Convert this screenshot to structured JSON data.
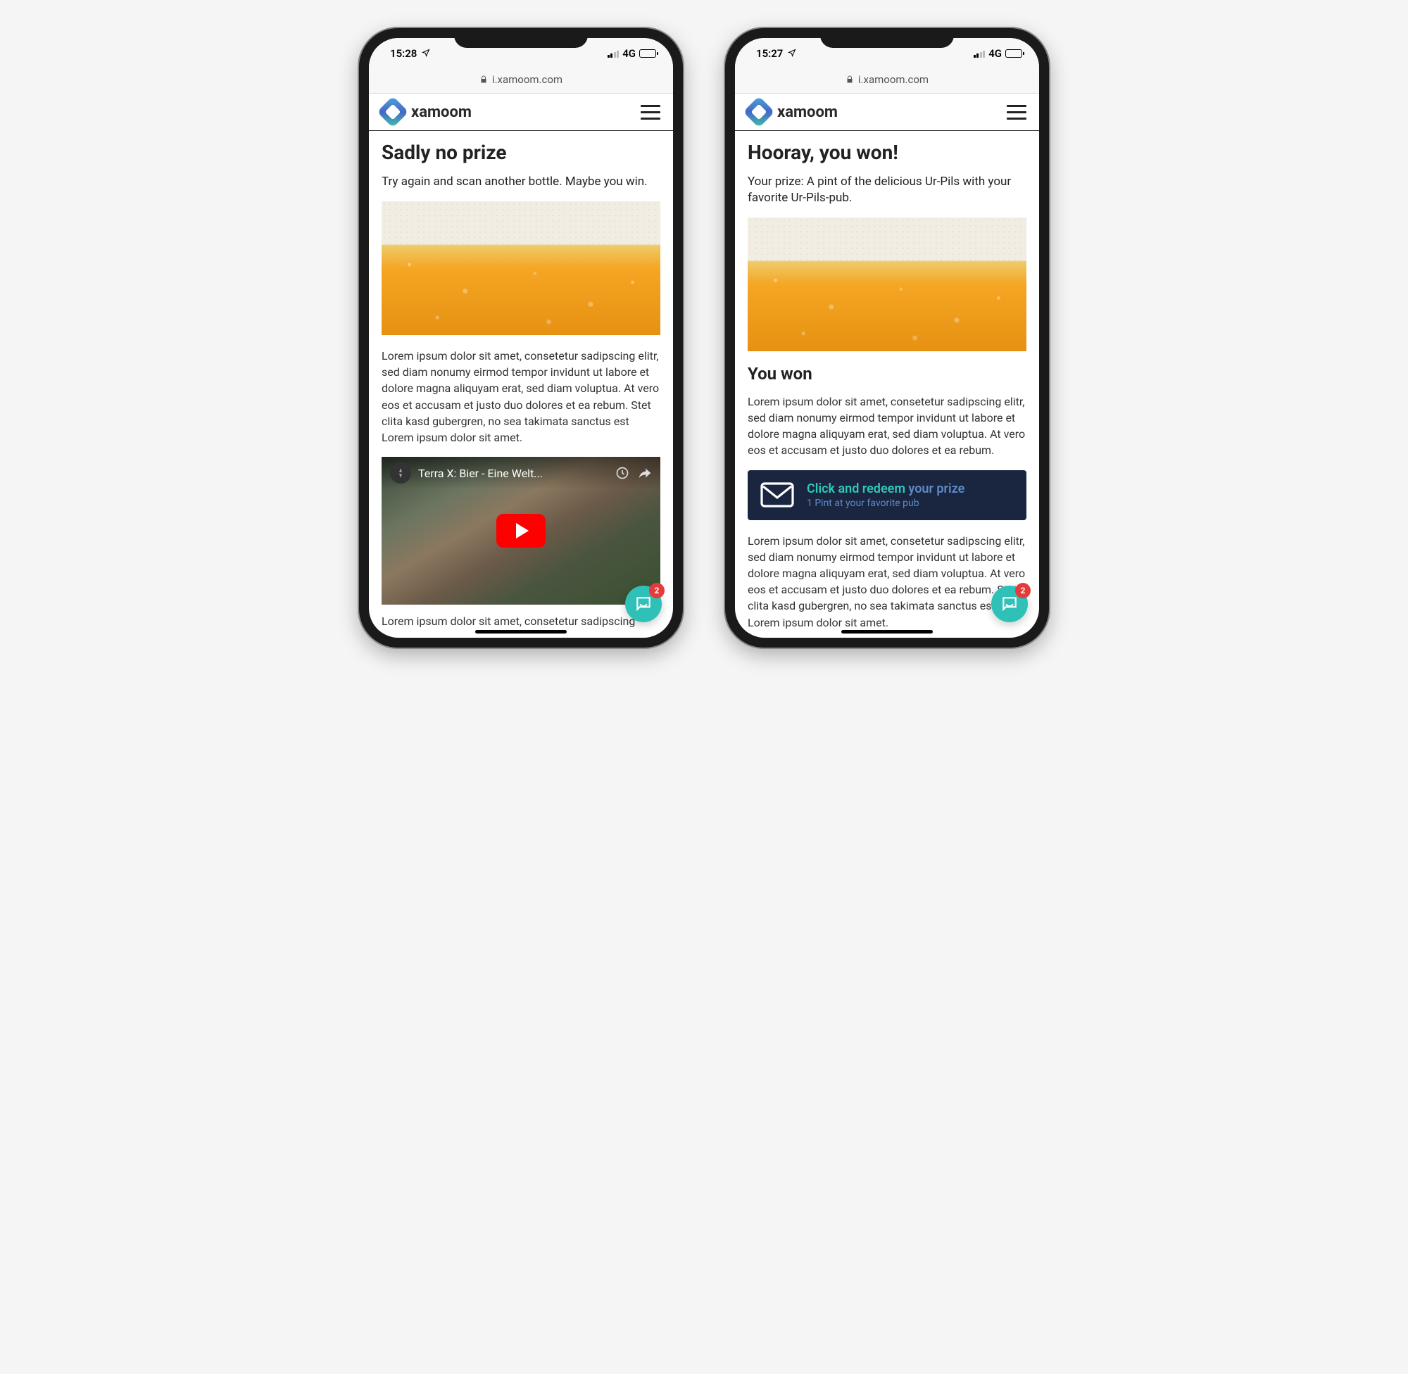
{
  "status": {
    "network": "4G"
  },
  "url": "i.xamoom.com",
  "brand": "xamoom",
  "phones": {
    "left": {
      "time": "15:28",
      "title": "Sadly no prize",
      "subtitle": "Try again and scan another bottle. Maybe you win.",
      "body1": "Lorem ipsum dolor sit amet, consetetur sadipscing elitr, sed diam nonumy eirmod tempor invidunt ut labore et dolore magna aliquyam erat, sed diam voluptua. At vero eos et accusam et justo duo dolores et ea rebum. Stet clita kasd gubergren, no sea takimata sanctus est Lorem ipsum dolor sit amet.",
      "video_title": "Terra X: Bier - Eine Welt...",
      "cutoff": "Lorem ipsum dolor sit amet, consetetur sadipscing",
      "chat_badge": "2"
    },
    "right": {
      "time": "15:27",
      "title": "Hooray, you won!",
      "subtitle": "Your prize: A pint of the delicious Ur-Pils with your favorite Ur-Pils-pub.",
      "section_title": "You won",
      "body1": "Lorem ipsum dolor sit amet, consetetur sadipscing elitr, sed diam nonumy eirmod tempor invidunt ut labore et dolore magna aliquyam erat, sed diam voluptua. At vero eos et accusam et justo duo dolores et ea rebum.",
      "redeem_title_a": "Click and redeem ",
      "redeem_title_b": "your prize",
      "redeem_sub": "1 Pint at your favorite pub",
      "body2": "Lorem ipsum dolor sit amet, consetetur sadipscing elitr, sed diam nonumy eirmod tempor invidunt ut labore et dolore magna aliquyam erat, sed diam voluptua. At vero eos et accusam et justo duo dolores et ea rebum. Stet clita kasd gubergren, no sea takimata sanctus est Lorem ipsum dolor sit amet.",
      "chat_badge": "2"
    }
  }
}
